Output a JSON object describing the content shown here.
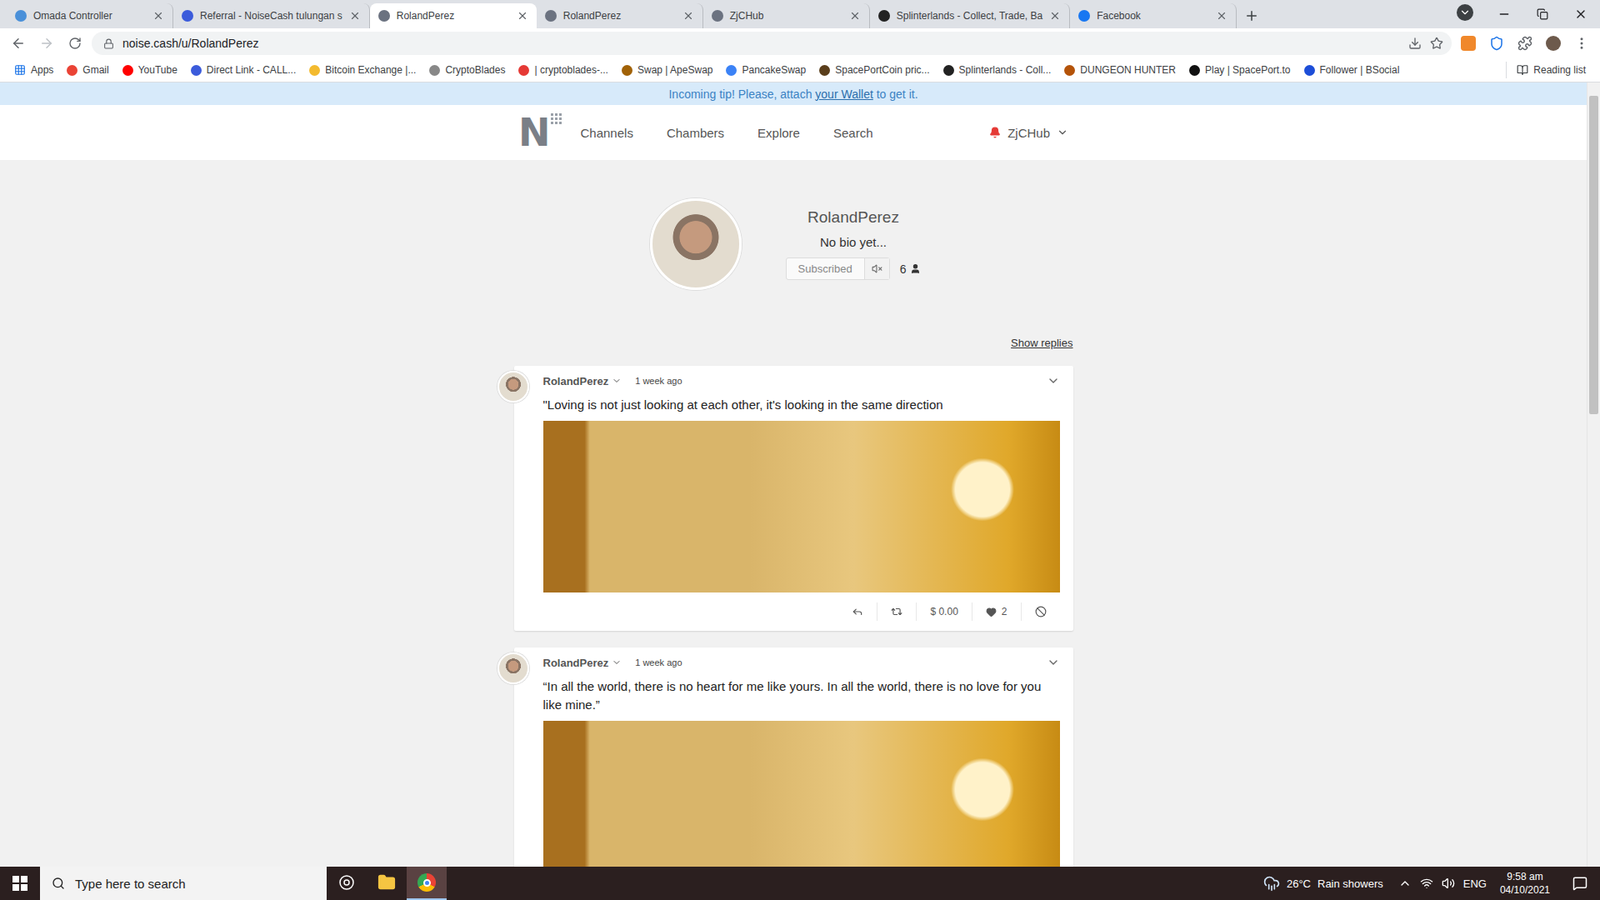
{
  "browser": {
    "tabs": [
      {
        "label": "Omada Controller",
        "selected": false,
        "color": "#4a90d9"
      },
      {
        "label": "Referral - NoiseCash tulungan s",
        "selected": false,
        "color": "#3b5bdb"
      },
      {
        "label": "RolandPerez",
        "selected": true,
        "color": "#6b7280"
      },
      {
        "label": "RolandPerez",
        "selected": false,
        "color": "#6b7280"
      },
      {
        "label": "ZjCHub",
        "selected": false,
        "color": "#6b7280"
      },
      {
        "label": "Splinterlands - Collect, Trade, Ba",
        "selected": false,
        "color": "#222222"
      },
      {
        "label": "Facebook",
        "selected": false,
        "color": "#1877f2"
      }
    ],
    "address": "noise.cash/u/RolandPerez",
    "bookmarks": [
      {
        "label": "Apps",
        "kind": "apps",
        "color": "#1a73e8"
      },
      {
        "label": "Gmail",
        "kind": "site",
        "color": "#ea4335"
      },
      {
        "label": "YouTube",
        "kind": "site",
        "color": "#ff0000"
      },
      {
        "label": "Direct Link - CALL...",
        "kind": "site",
        "color": "#3b5bdb"
      },
      {
        "label": "Bitcoin Exchange |...",
        "kind": "site",
        "color": "#f3ba2f"
      },
      {
        "label": "CryptoBlades",
        "kind": "site",
        "color": "#888888"
      },
      {
        "label": "| cryptoblades-...",
        "kind": "site",
        "color": "#e53935"
      },
      {
        "label": "Swap | ApeSwap",
        "kind": "site",
        "color": "#a16207"
      },
      {
        "label": "PancakeSwap",
        "kind": "site",
        "color": "#3b82f6"
      },
      {
        "label": "SpacePortCoin pric...",
        "kind": "site",
        "color": "#5a3e1b"
      },
      {
        "label": "Splinterlands - Coll...",
        "kind": "site",
        "color": "#222222"
      },
      {
        "label": "DUNGEON HUNTER",
        "kind": "site",
        "color": "#b45309"
      },
      {
        "label": "Play | SpacePort.to",
        "kind": "site",
        "color": "#111111"
      },
      {
        "label": "Follower | BSocial",
        "kind": "site",
        "color": "#1d4ed8"
      }
    ],
    "reading_list": "Reading list"
  },
  "page": {
    "notice": {
      "before": "Incoming tip! Please, attach ",
      "link": "your Wallet",
      "after": " to get it."
    },
    "header": {
      "logo": "N",
      "nav": [
        "Channels",
        "Chambers",
        "Explore",
        "Search"
      ],
      "user": "ZjCHub",
      "has_notifications": true
    },
    "profile": {
      "name": "RolandPerez",
      "bio": "No bio yet...",
      "subscribe_label": "Subscribed",
      "subscribers": "6"
    },
    "show_replies": "Show replies",
    "posts": [
      {
        "author": "RolandPerez",
        "time": "1 week ago",
        "text": "\"Loving is not just looking at each other, it's looking in the same direction",
        "tip": "$ 0.00",
        "likes": "2"
      },
      {
        "author": "RolandPerez",
        "time": "1 week ago",
        "text": "“In all the world, there is no heart for me like yours. In all the world, there is no love for you like mine.”"
      }
    ],
    "scrollbar": {
      "level": 0.42
    }
  },
  "taskbar": {
    "search_placeholder": "Type here to search",
    "apps": [
      {
        "kind": "task",
        "active": false
      },
      {
        "kind": "folder",
        "active": false
      },
      {
        "kind": "chrome",
        "active": true
      }
    ],
    "weather": {
      "temp": "26°C",
      "condition": "Rain showers"
    },
    "language": "ENG",
    "time": "9:58 am",
    "date": "04/10/2021"
  }
}
